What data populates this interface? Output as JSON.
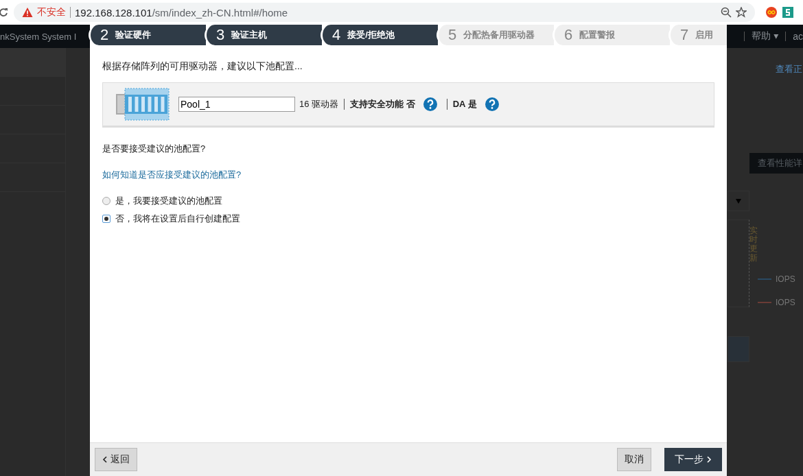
{
  "browser": {
    "security_label": "不安全",
    "url": {
      "host": "192.168.128.101",
      "path": "/sm/index_zh-CN.html#/home"
    }
  },
  "background": {
    "app_title": "nkSystem System I",
    "header_links": [
      {
        "label": "帮助 ▾"
      },
      {
        "label": "ac"
      }
    ],
    "view_link": "查看正",
    "perf_button": "查看性能详",
    "live_update": "实时更新",
    "legend": [
      {
        "label": "IOPS",
        "color": "#2a4a63"
      },
      {
        "label": "IOPS",
        "color": "#6a3b35"
      }
    ]
  },
  "wizard": {
    "steps": [
      {
        "number": "2",
        "label": "验证硬件",
        "reached": true
      },
      {
        "number": "3",
        "label": "验证主机",
        "reached": true
      },
      {
        "number": "4",
        "label": "接受/拒绝池",
        "reached": true
      },
      {
        "number": "5",
        "label": "分配热备用驱动器",
        "reached": false
      },
      {
        "number": "6",
        "label": "配置警报",
        "reached": false
      },
      {
        "number": "7",
        "label": "启用",
        "reached": false
      }
    ],
    "intro": "根据存储阵列的可用驱动器，建议以下池配置...",
    "pool": {
      "name": "Pool_1",
      "drives": "16 驱动器",
      "security_label": "支持安全功能 否",
      "da_label": "DA 是"
    },
    "question": "是否要接受建议的池配置?",
    "help_link": "如何知道是否应接受建议的池配置?",
    "options": [
      {
        "label": "是，我要接受建议的池配置",
        "selected": false
      },
      {
        "label": "否，我将在设置后自行创建配置",
        "selected": true
      }
    ],
    "back_button": "返回",
    "cancel_button": "取消",
    "next_button": "下一步"
  }
}
